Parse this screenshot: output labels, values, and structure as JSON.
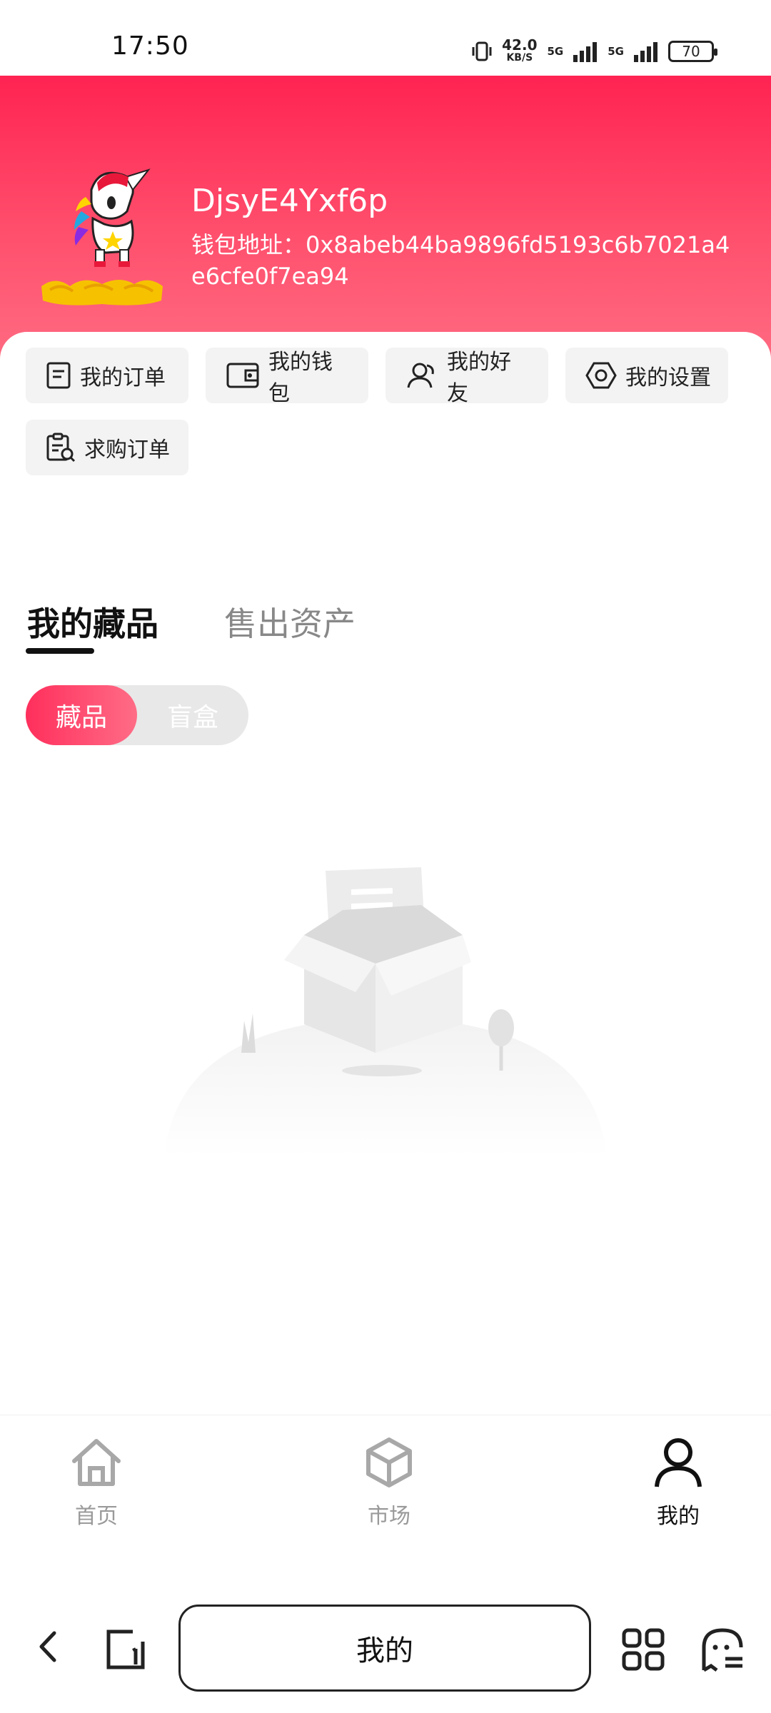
{
  "status_bar": {
    "time": "17:50",
    "net_speed": "42.0",
    "net_unit": "KB/S",
    "sim1": "5G",
    "sim2": "5G",
    "battery": "70"
  },
  "profile": {
    "username": "DjsyE4Yxf6p",
    "wallet_label": "钱包地址：",
    "wallet_address": "0x8abeb44ba9896fd5193c6b7021a4e6cfe0f7ea94"
  },
  "quick_actions": [
    {
      "label": "我的订单",
      "icon": "order-icon"
    },
    {
      "label": "我的钱包",
      "icon": "wallet-icon"
    },
    {
      "label": "我的好友",
      "icon": "friends-icon"
    },
    {
      "label": "我的设置",
      "icon": "settings-icon"
    },
    {
      "label": "求购订单",
      "icon": "purchase-order-icon"
    }
  ],
  "tabs": [
    {
      "label": "我的藏品",
      "active": true
    },
    {
      "label": "售出资产",
      "active": false
    }
  ],
  "segment": {
    "options": [
      "藏品",
      "盲盒"
    ],
    "selected": "藏品"
  },
  "bottom_nav": [
    {
      "label": "首页",
      "icon": "home-icon",
      "active": false
    },
    {
      "label": "市场",
      "icon": "market-cube-icon",
      "active": false
    },
    {
      "label": "我的",
      "icon": "user-icon",
      "active": true
    }
  ],
  "browser_bar": {
    "url_label": "我的"
  },
  "colors": {
    "brand": "#ff2352",
    "brand_light": "#ff6b82"
  }
}
